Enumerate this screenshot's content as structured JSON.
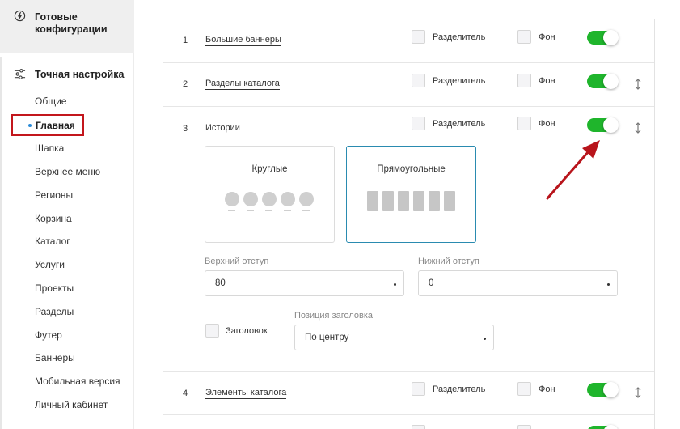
{
  "sidebar": {
    "ready_label": "Готовые конфигурации",
    "fine_label": "Точная настройка",
    "active_item": "Главная",
    "items": [
      "Общие",
      "Шапка",
      "Верхнее меню",
      "Регионы",
      "Корзина",
      "Каталог",
      "Услуги",
      "Проекты",
      "Разделы",
      "Футер",
      "Баннеры",
      "Мобильная версия",
      "Личный кабинет"
    ]
  },
  "rows": [
    {
      "num": "1",
      "name": "Большие баннеры",
      "separator": "Разделитель",
      "bg": "Фон",
      "enabled": true
    },
    {
      "num": "2",
      "name": "Разделы каталога",
      "separator": "Разделитель",
      "bg": "Фон",
      "enabled": true
    },
    {
      "num": "3",
      "name": "Истории",
      "separator": "Разделитель",
      "bg": "Фон",
      "enabled": true
    },
    {
      "num": "4",
      "name": "Элементы каталога",
      "separator": "Разделитель",
      "bg": "Фон",
      "enabled": true
    }
  ],
  "stories": {
    "view_round": "Круглые",
    "view_rect": "Прямоугольные",
    "selected_view": "Прямоугольные",
    "top_padding_label": "Верхний отступ",
    "top_padding_value": "80",
    "bottom_padding_label": "Нижний отступ",
    "bottom_padding_value": "0",
    "heading_label": "Заголовок",
    "heading_position_label": "Позиция заголовка",
    "heading_position_value": "По центру"
  },
  "colors": {
    "toggle_on": "#1fb52c",
    "highlight": "#c3161c",
    "selected_card": "#2a8bb0",
    "active_dot": "#2a8bd8"
  }
}
